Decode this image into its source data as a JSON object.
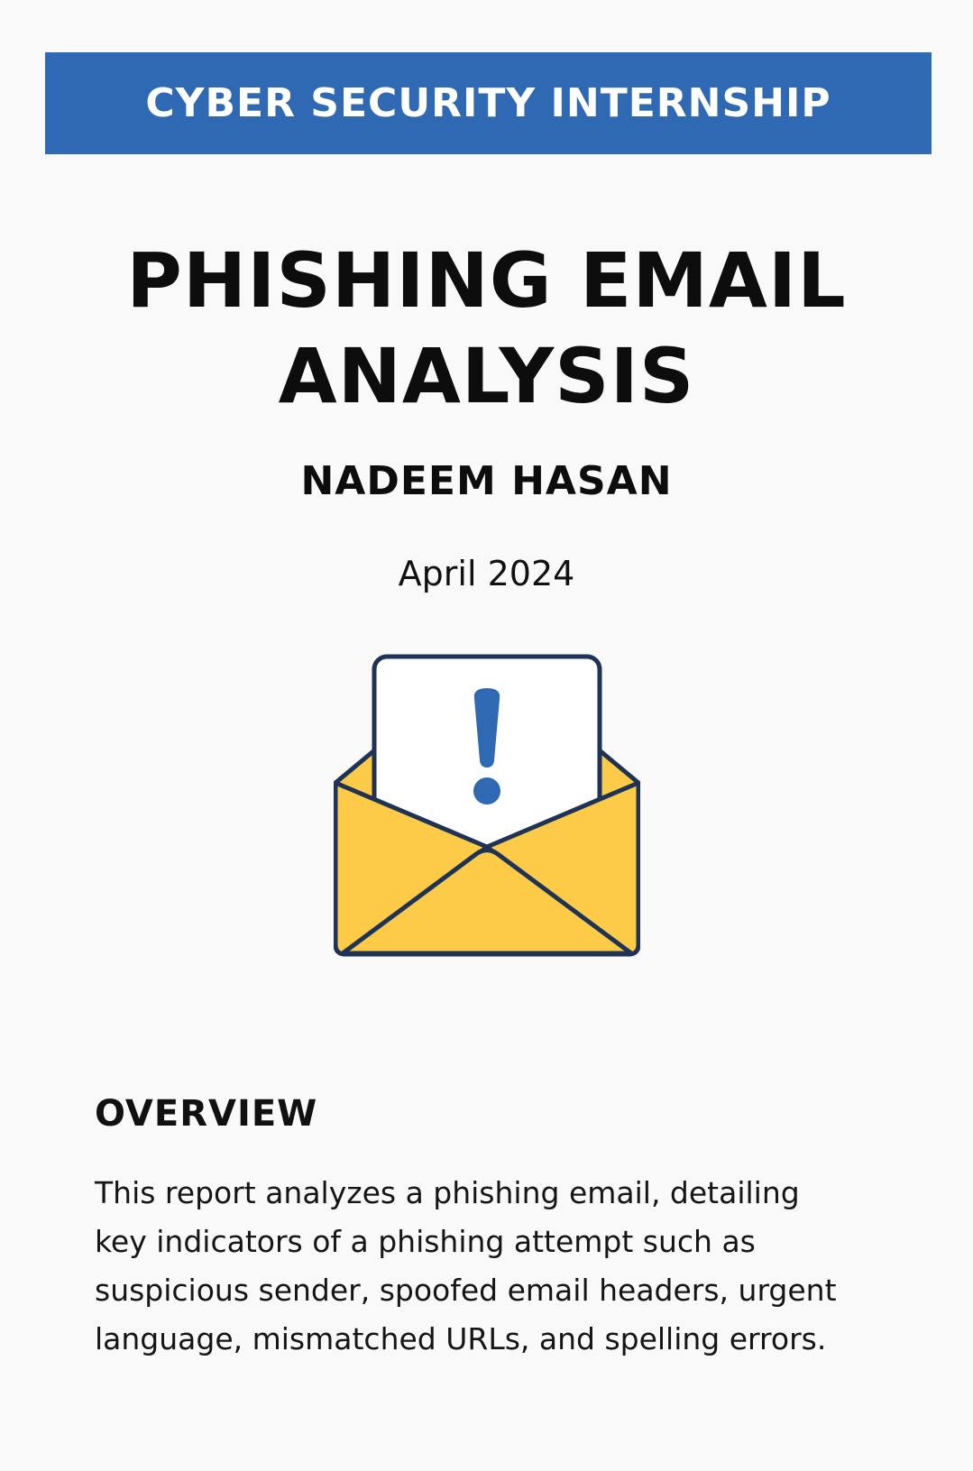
{
  "header": {
    "banner_text": "CYBER SECURITY INTERNSHIP"
  },
  "title": {
    "line1": "PHISHING EMAIL",
    "line2": "ANALYSIS"
  },
  "author": "NADEEM HASAN",
  "date": "April 2024",
  "illustration": {
    "icon_name": "envelope-warning-icon",
    "envelope_color": "#fdcb47",
    "outline_color": "#1e3355",
    "mark_color": "#2f69b3"
  },
  "overview": {
    "heading": "OVERVIEW",
    "lines": [
      "This report analyzes a phishing email, detailing",
      "key indicators of a phishing attempt such as",
      "suspicious sender, spoofed email headers, urgent",
      "language, mismatched URLs, and spelling errors."
    ]
  },
  "colors": {
    "banner": "#2f69b3",
    "background": "#f9f9f9",
    "text": "#111111"
  }
}
